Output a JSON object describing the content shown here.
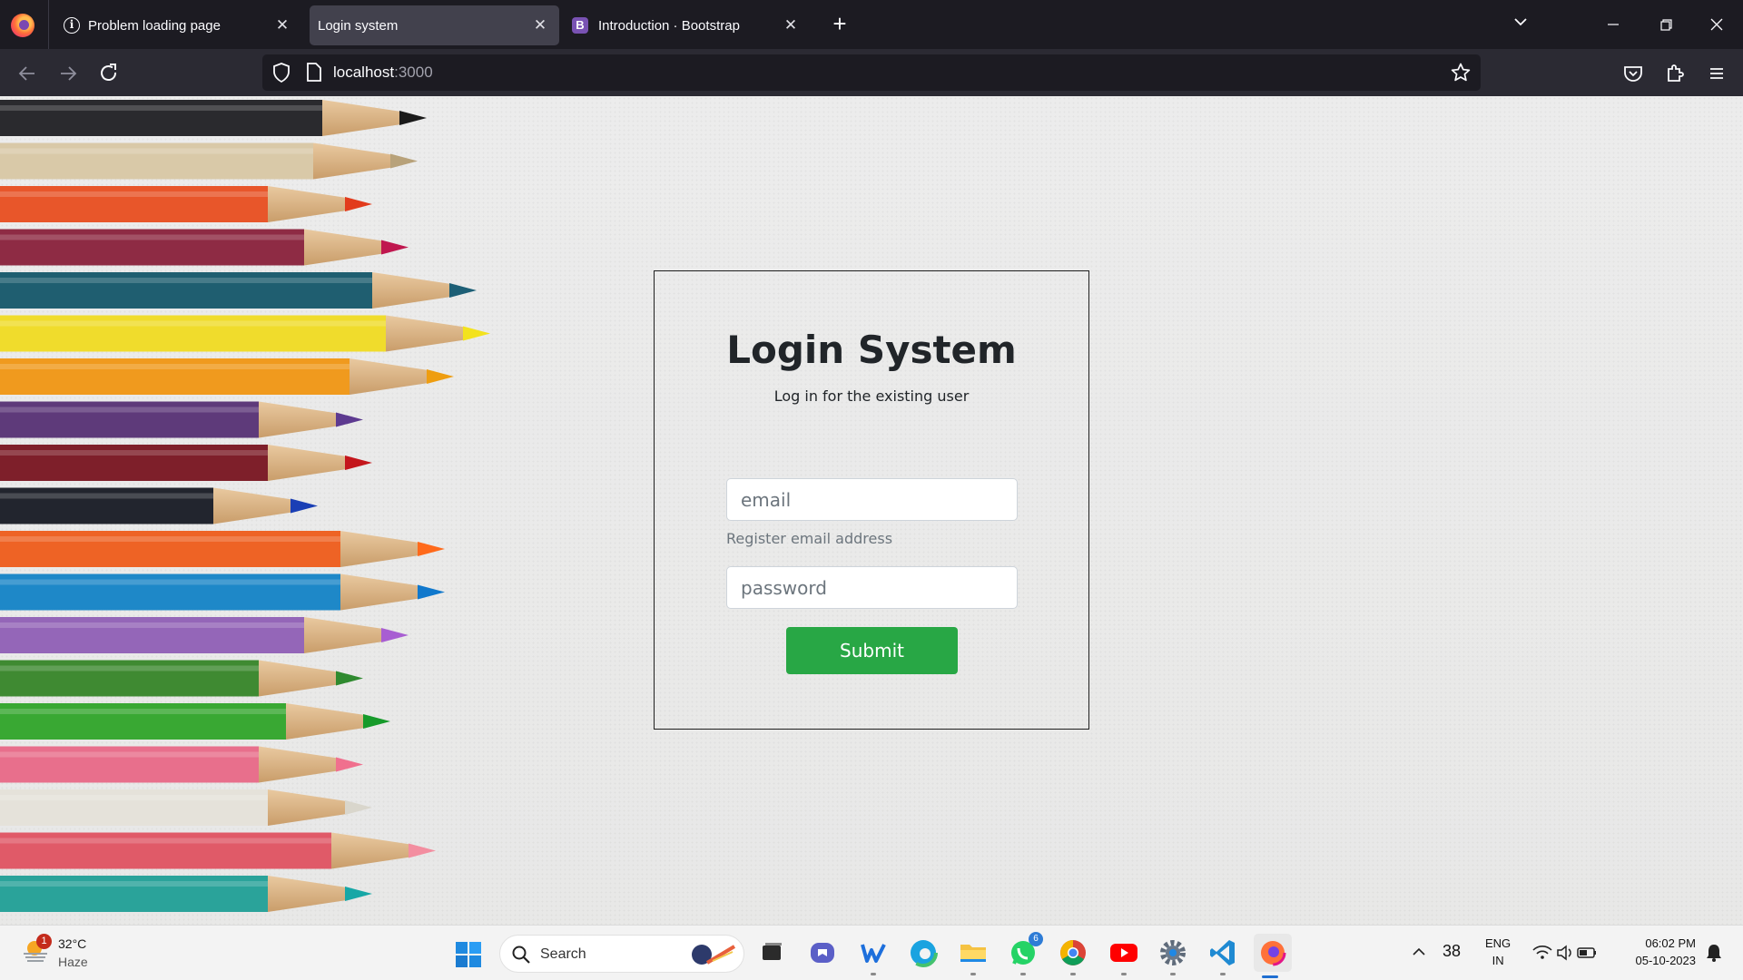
{
  "browser": {
    "tabs": [
      {
        "label": "Problem loading page",
        "icon": "info-icon"
      },
      {
        "label": "Login system",
        "icon": "none",
        "active": true
      },
      {
        "label": "Introduction · Bootstrap",
        "icon": "bootstrap-icon"
      }
    ],
    "close_glyph": "✕",
    "new_tab_glyph": "+",
    "url_host": "localhost",
    "url_port": ":3000"
  },
  "login": {
    "title": "Login System",
    "subtitle": "Log in for the existing user",
    "email_placeholder": "email",
    "email_help": "Register email address",
    "password_placeholder": "password",
    "submit_label": "Submit",
    "submit_color": "#28a745"
  },
  "taskbar": {
    "weather_temp": "32°C",
    "weather_condition": "Haze",
    "weather_badge": "1",
    "search_label": "Search",
    "whatsapp_badge": "6",
    "apps": [
      "file-explorer-icon",
      "teams-icon",
      "word-icon",
      "edge-icon",
      "folder-icon",
      "whatsapp-icon",
      "chrome-icon",
      "youtube-icon",
      "settings-icon",
      "vscode-icon",
      "firefox-icon"
    ],
    "tray_number": "38",
    "lang_line1": "ENG",
    "lang_line2": "IN",
    "time": "06:02 PM",
    "date": "05-10-2023"
  }
}
